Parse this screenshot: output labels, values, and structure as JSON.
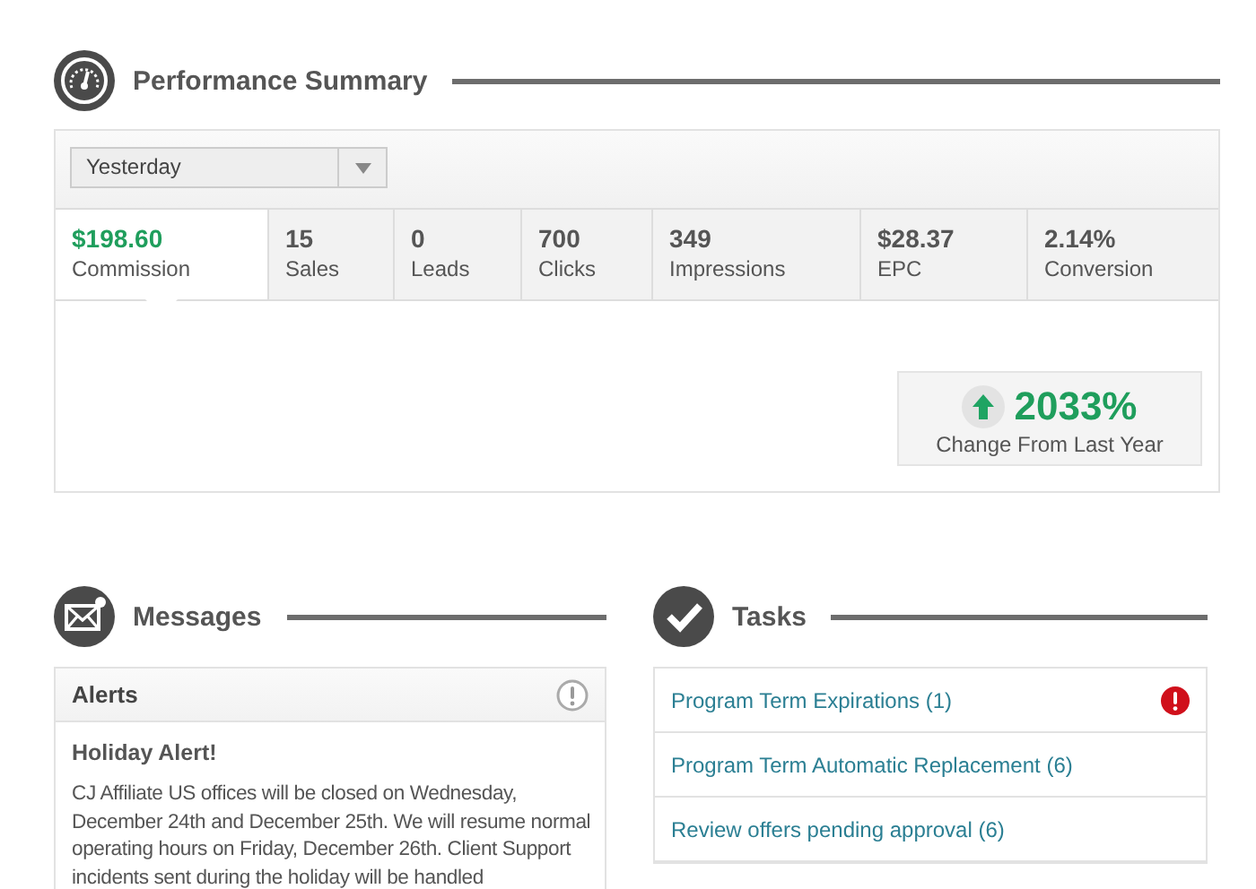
{
  "performance": {
    "title": "Performance Summary",
    "period": {
      "value": "Yesterday"
    },
    "metrics": [
      {
        "value": "$198.60",
        "label": "Commission",
        "selected": true
      },
      {
        "value": "15",
        "label": "Sales",
        "selected": false
      },
      {
        "value": "0",
        "label": "Leads",
        "selected": false
      },
      {
        "value": "700",
        "label": "Clicks",
        "selected": false
      },
      {
        "value": "349",
        "label": "Impressions",
        "selected": false
      },
      {
        "value": "$28.37",
        "label": "EPC",
        "selected": false
      },
      {
        "value": "2.14%",
        "label": "Conversion",
        "selected": false
      }
    ],
    "change": {
      "value": "2033%",
      "label": "Change From Last Year"
    }
  },
  "messages": {
    "title": "Messages",
    "panel_title": "Alerts",
    "alert_title": "Holiday Alert!",
    "alert_text": "CJ Affiliate US offices will be closed on Wednesday, December 24th and December 25th. We will resume normal operating hours on Friday, December 26th. Client Support incidents sent during the holiday will be handled"
  },
  "tasks": {
    "title": "Tasks",
    "items": [
      {
        "label": "Program Term Expirations (1)",
        "alert": true
      },
      {
        "label": "Program Term Automatic Replacement (6)",
        "alert": false
      },
      {
        "label": "Review offers pending approval (6)",
        "alert": false
      }
    ]
  }
}
